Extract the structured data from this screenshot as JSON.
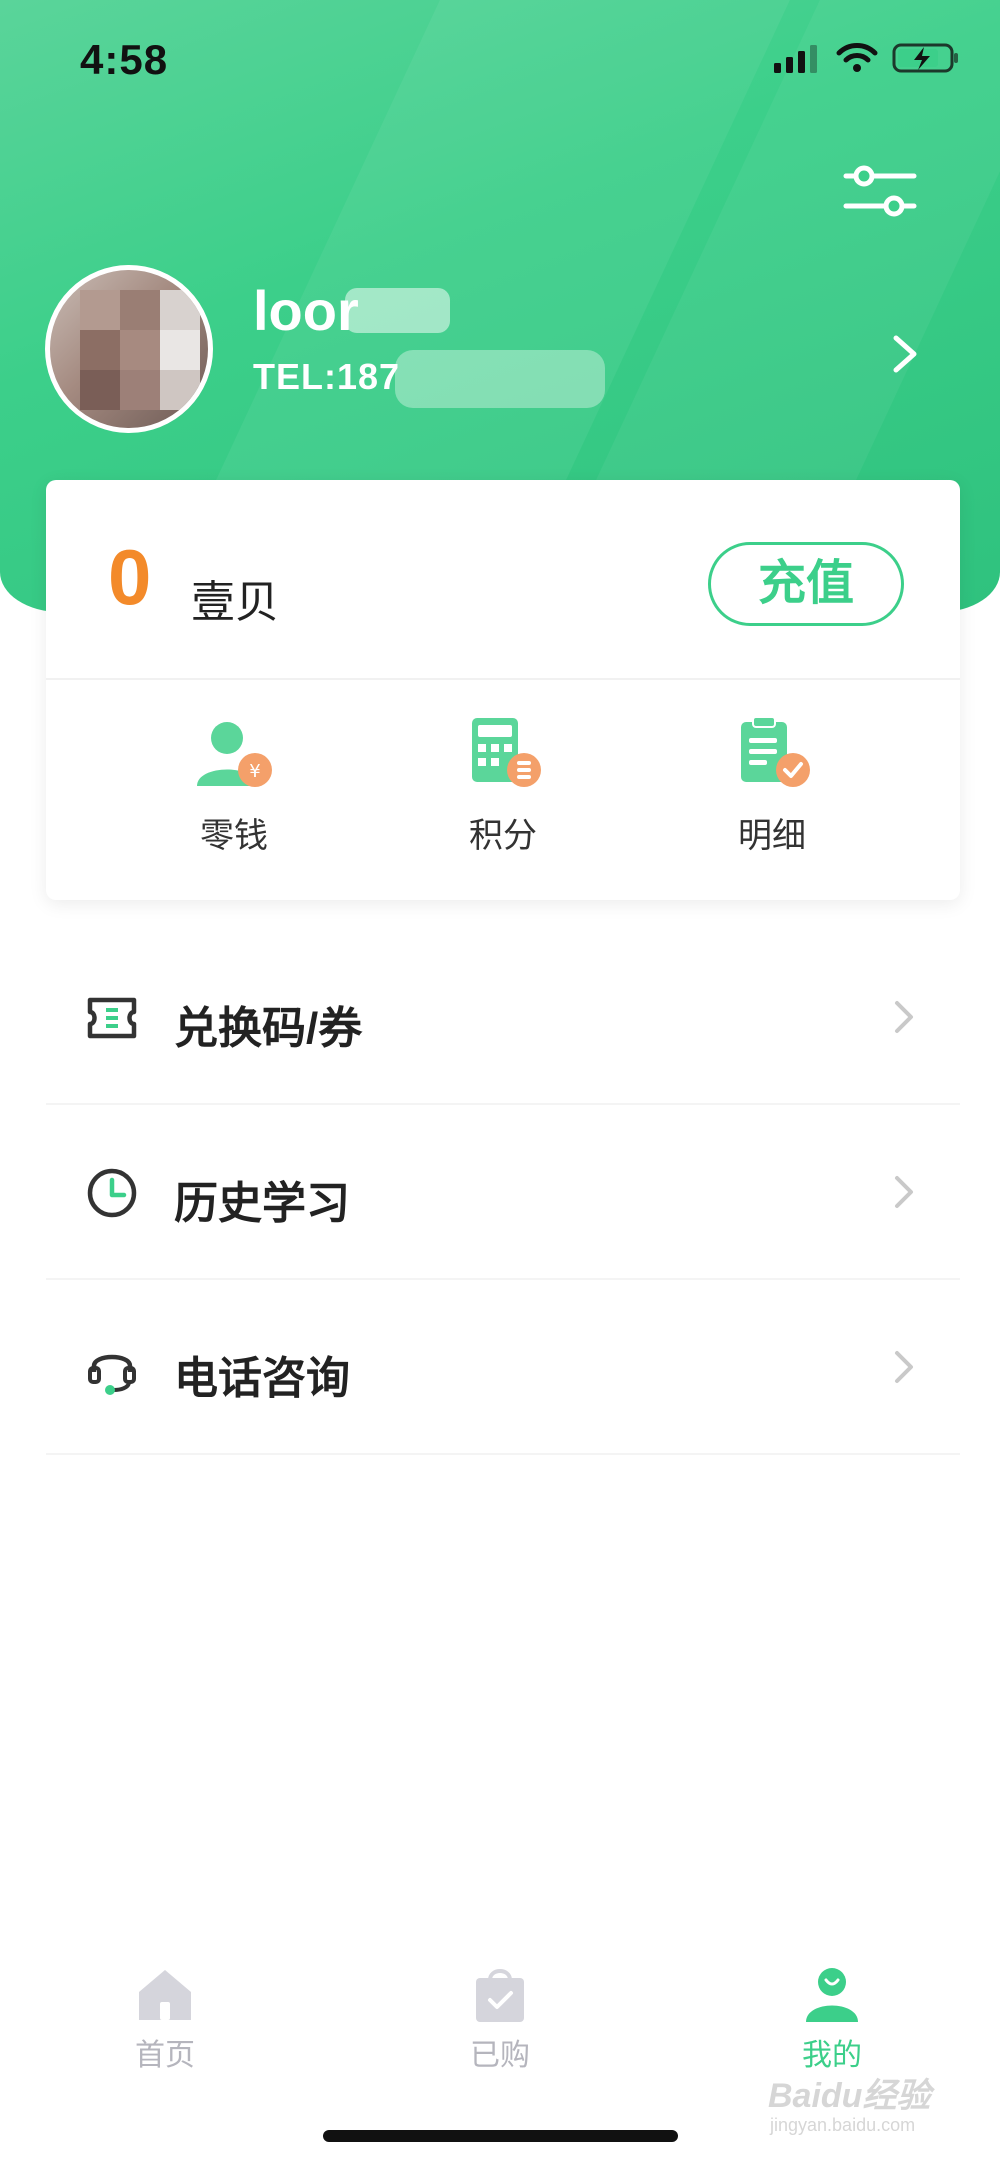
{
  "status_bar": {
    "time": "4:58"
  },
  "profile": {
    "username": "loor",
    "tel": "TEL:187"
  },
  "wallet": {
    "balance": "0",
    "currency_label": "壹贝",
    "recharge_label": "充值",
    "shortcuts": [
      {
        "label": "零钱",
        "icon": "user-coin-icon"
      },
      {
        "label": "积分",
        "icon": "calculator-coin-icon"
      },
      {
        "label": "明细",
        "icon": "clipboard-check-icon"
      }
    ]
  },
  "menu": {
    "items": [
      {
        "label": "兑换码/券",
        "icon": "ticket-icon"
      },
      {
        "label": "历史学习",
        "icon": "clock-icon"
      },
      {
        "label": "电话咨询",
        "icon": "headset-icon"
      }
    ]
  },
  "tabbar": {
    "tabs": [
      {
        "label": "首页",
        "icon": "home-icon",
        "active": false
      },
      {
        "label": "已购",
        "icon": "shopping-bag-check-icon",
        "active": false
      },
      {
        "label": "我的",
        "icon": "profile-icon",
        "active": true
      }
    ]
  },
  "watermark": {
    "text": "Baidu经验",
    "sub": "jingyan.baidu.com"
  },
  "colors": {
    "brand_green": "#3ccf8a",
    "balance_orange": "#f38a2a",
    "inactive_tab": "#b5b5bd"
  }
}
